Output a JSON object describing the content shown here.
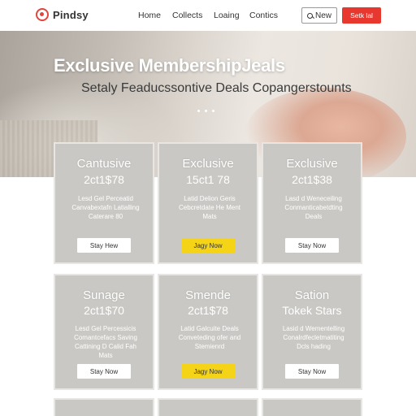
{
  "header": {
    "brand": "Pindsy",
    "nav": [
      "Home",
      "Collects",
      "Loaing",
      "Contics"
    ],
    "search_label": "New",
    "cta_label": "Setk lal"
  },
  "hero": {
    "title": "Exclusive MembershipJeals",
    "subtitle": "Setaly Feaducssontive Deals Copangerstounts"
  },
  "cards": [
    {
      "title": "Cantusive",
      "price": "2ct1$78",
      "desc": [
        "Lesd Gel Perceatid",
        "Canvabextafn Latialling",
        "Caterare 80"
      ],
      "button": "Stay Hew",
      "variant": "white"
    },
    {
      "title": "Exclusive",
      "price": "15ct1 78",
      "desc": [
        "Latid Delion Geris",
        "Cebcretdate He Ment",
        "Mats"
      ],
      "button": "Jagy Now",
      "variant": "yellow"
    },
    {
      "title": "Exclusive",
      "price": "2ct1$38",
      "desc": [
        "Lasd d Weneceiling",
        "Conmanticabetdting",
        "Deals"
      ],
      "button": "Stay Now",
      "variant": "white"
    },
    {
      "title": "Sunage",
      "price": "2ct1$70",
      "desc": [
        "Lesd Gel Percessicis",
        "Comantcefacs Saving",
        "Cattining D Calid Fah",
        "Mats"
      ],
      "button": "Stay Now",
      "variant": "white"
    },
    {
      "title": "Smende",
      "price": "2ct1$78",
      "desc": [
        "Latid Galcuite Deals",
        "Conveteding ofer and",
        "Stemienrd"
      ],
      "button": "Jagy Now",
      "variant": "yellow"
    },
    {
      "title": "Sation",
      "price": "Tokek Stars",
      "desc": [
        "Lasid d Wementelling",
        "Conalrdfecletmatiting",
        "Dcls hading"
      ],
      "button": "Stay Now",
      "variant": "white"
    }
  ]
}
